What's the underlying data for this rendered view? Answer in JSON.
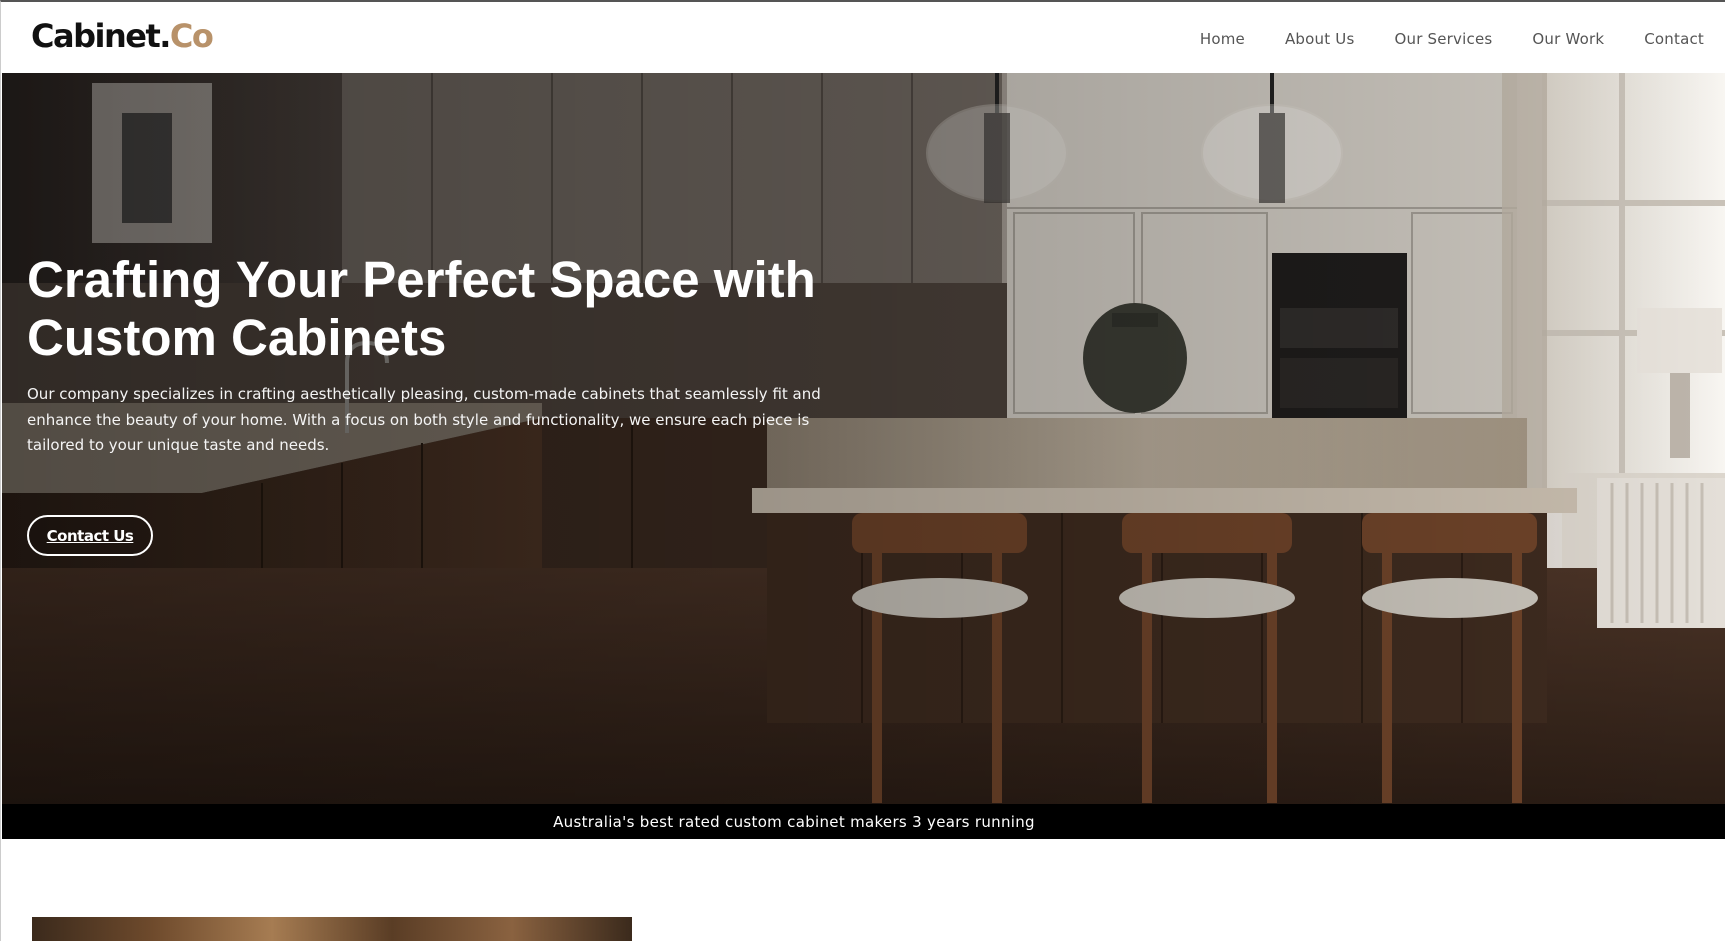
{
  "brand": {
    "name": "Cabinet",
    "dot": ".",
    "suffix": "Co",
    "accent_color": "#b8926a"
  },
  "nav": {
    "items": [
      {
        "label": "Home"
      },
      {
        "label": "About Us"
      },
      {
        "label": "Our Services"
      },
      {
        "label": "Our Work"
      },
      {
        "label": "Contact"
      }
    ]
  },
  "hero": {
    "title": "Crafting Your Perfect Space with Custom Cabinets",
    "description": "Our company specializes in crafting aesthetically pleasing, custom-made cabinets that seamlessly fit and enhance the beauty of your home. With a focus on both style and functionality, we ensure each piece is tailored to your unique taste and needs.",
    "cta_label": "Contact Us"
  },
  "banner": {
    "text": "Australia's best rated custom cabinet makers 3 years running"
  }
}
